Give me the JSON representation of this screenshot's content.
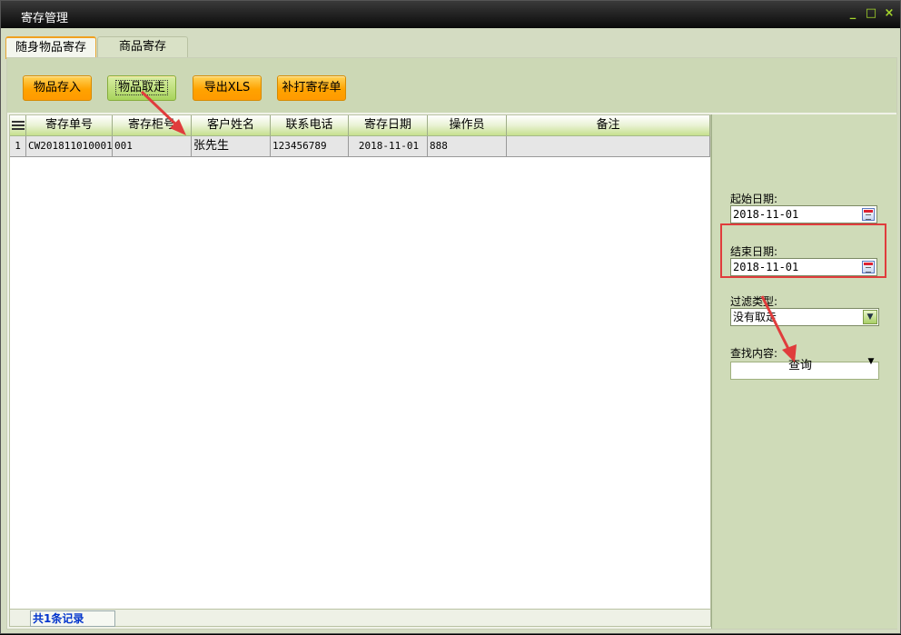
{
  "window": {
    "title": "寄存管理",
    "controls": [
      "_",
      "□",
      "×"
    ]
  },
  "tabs": [
    {
      "label": "随身物品寄存",
      "active": true
    },
    {
      "label": "商品寄存",
      "active": false
    }
  ],
  "toolbar": {
    "deposit_label": "物品存入",
    "takeout_label": "物品取走",
    "export_label": "导出XLS",
    "reprint_label": "补打寄存单"
  },
  "table": {
    "columns": [
      "寄存单号",
      "寄存柜号",
      "客户姓名",
      "联系电话",
      "寄存日期",
      "操作员",
      "备注"
    ],
    "rows": [
      {
        "index": "1",
        "cells": [
          "CW201811010001",
          "001",
          "张先生",
          "123456789",
          "2018-11-01",
          "888",
          ""
        ]
      }
    ]
  },
  "status": {
    "record_count": "共1条记录"
  },
  "filters": {
    "start_label": "起始日期:",
    "start_value": "2018-11-01",
    "end_label": "结束日期:",
    "end_value": "2018-11-01",
    "type_label": "过滤类型:",
    "type_value": "没有取走",
    "search_label": "查找内容:",
    "search_value": "",
    "query_label": "查询"
  },
  "colors": {
    "accent_orange": "#ffa300",
    "annotation_red": "#e03c3c",
    "status_blue": "#0033cc"
  }
}
